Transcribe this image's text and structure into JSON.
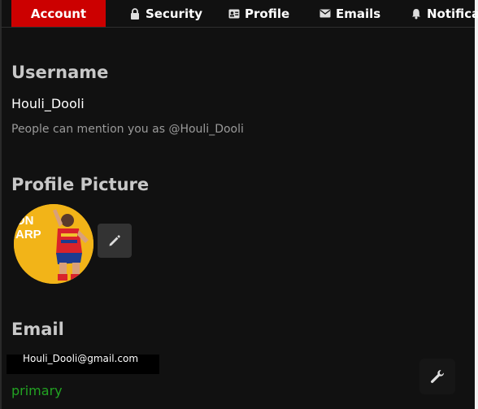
{
  "tabs": [
    {
      "label": "Account",
      "icon": "none",
      "active": true
    },
    {
      "label": "Security",
      "icon": "lock-icon",
      "active": false
    },
    {
      "label": "Profile",
      "icon": "id-card-icon",
      "active": false
    },
    {
      "label": "Emails",
      "icon": "envelope-icon",
      "active": false
    },
    {
      "label": "Notifications",
      "icon": "bell-icon",
      "active": false
    }
  ],
  "username": {
    "heading": "Username",
    "value": "Houli_Dooli",
    "hint": "People can mention you as @Houli_Dooli"
  },
  "profile_picture": {
    "heading": "Profile Picture",
    "avatar_text": "ON ARP",
    "edit_icon": "pencil-icon"
  },
  "email": {
    "heading": "Email",
    "value": "Houli_Dooli@gmail.com",
    "status": "primary"
  },
  "floating_action": {
    "icon": "wrench-icon"
  },
  "colors": {
    "background": "#111111",
    "active_tab": "#cc0000",
    "heading": "#c8c8c8",
    "hint": "#9a9a9a",
    "primary_status": "#22a322",
    "avatar_bg": "#f2b418"
  }
}
